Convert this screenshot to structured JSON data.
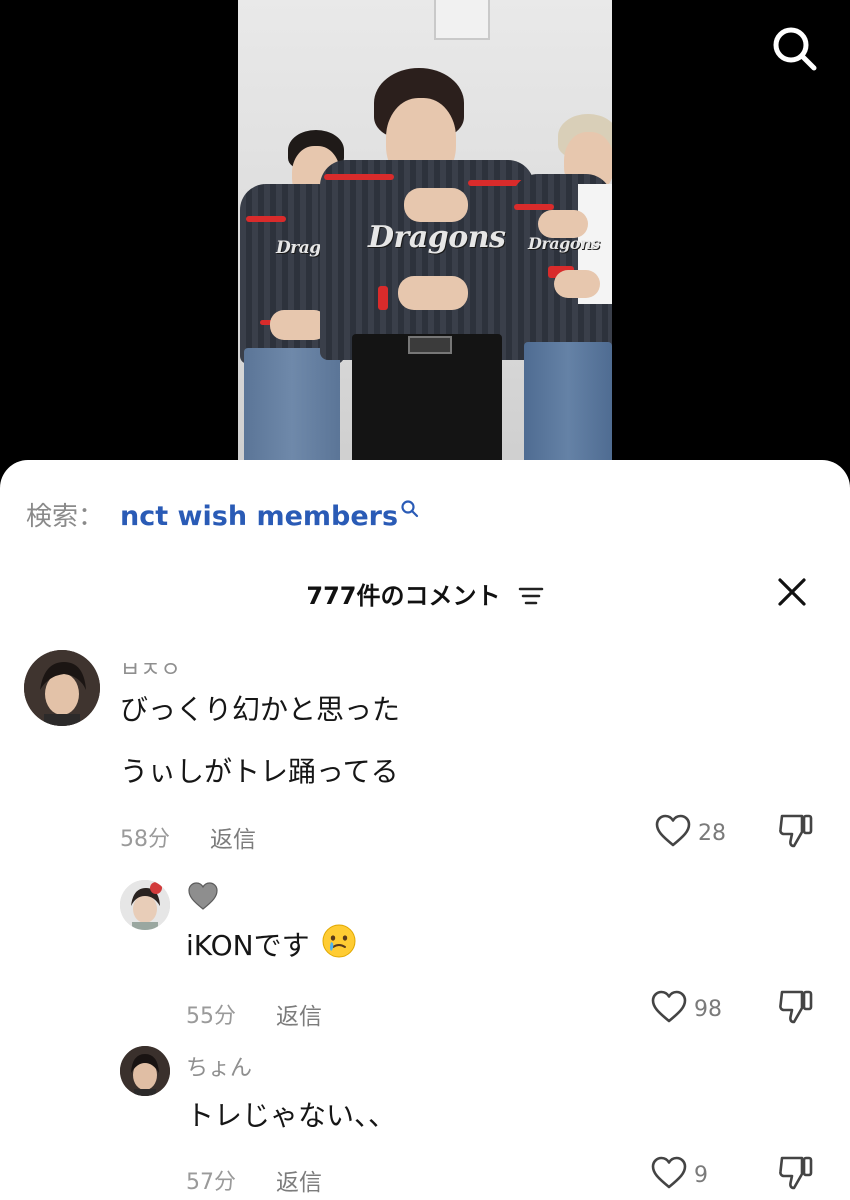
{
  "video": {
    "jersey_logo_text": "Dragons"
  },
  "search": {
    "label": "検索：",
    "query": "nct wish members"
  },
  "comments_header": {
    "title": "777件のコメント"
  },
  "comments": [
    {
      "username": "ㅂㅈㅇ",
      "lines": [
        "びっくり幻かと思った",
        "うぃしがトレ踊ってる"
      ],
      "time": "58分",
      "reply_label": "返信",
      "likes": "28"
    },
    {
      "username_icon": "gray-heart-icon",
      "text": "iKONです",
      "emoji": "face-holding-back-tears",
      "time": "55分",
      "reply_label": "返信",
      "likes": "98"
    },
    {
      "username": "ちょん",
      "text": "トレじゃない、、",
      "time": "57分",
      "reply_label": "返信",
      "likes": "9"
    }
  ],
  "colors": {
    "query_link": "#2a5bb6",
    "muted_text": "#8f8f8f",
    "background_top": "#000000",
    "sheet": "#ffffff"
  }
}
